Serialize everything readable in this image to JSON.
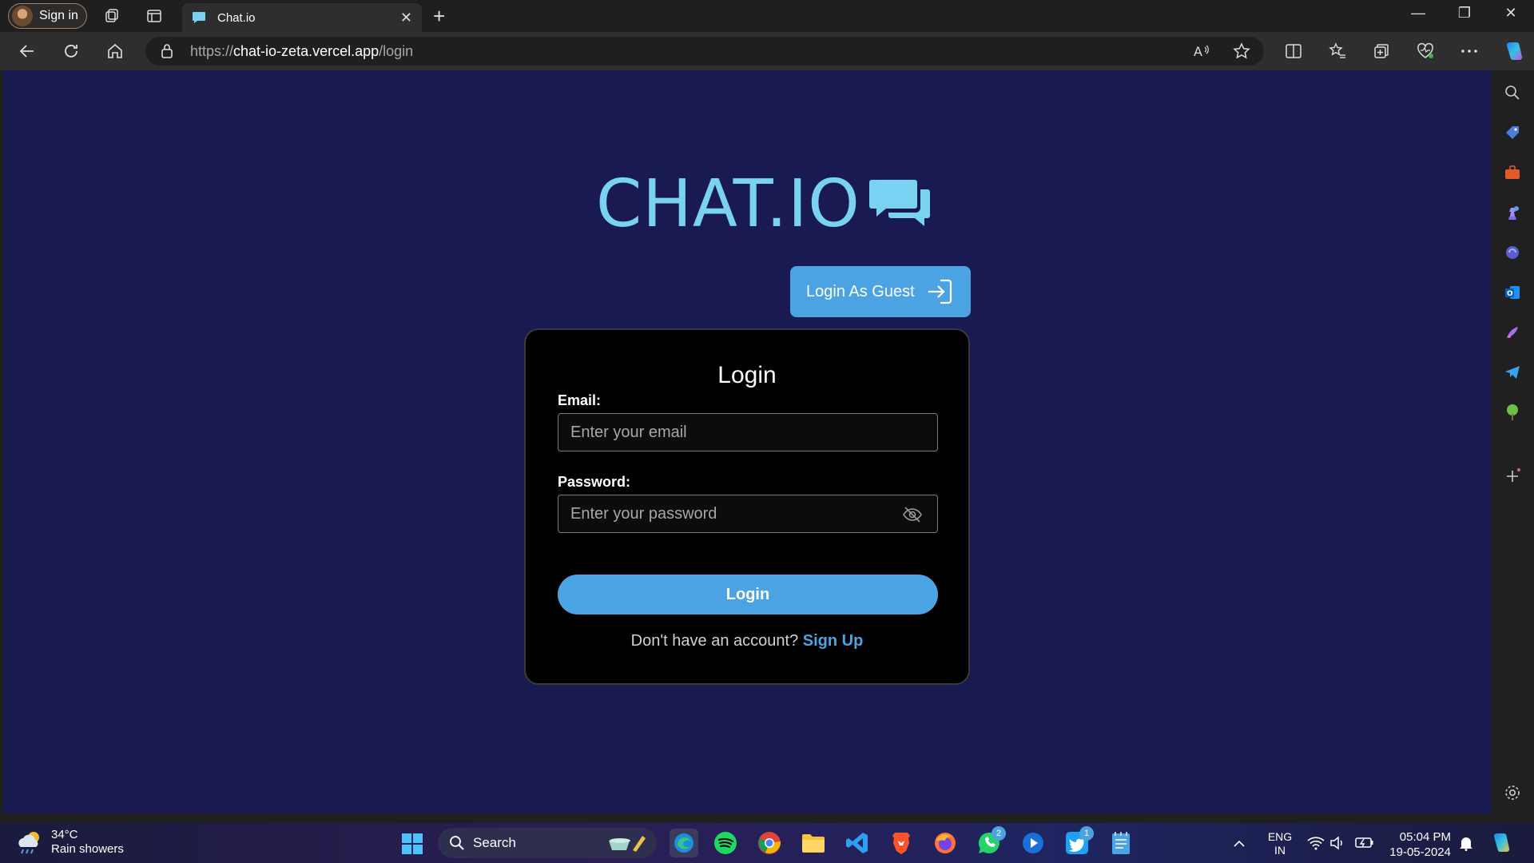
{
  "browser": {
    "profile_label": "Sign in",
    "tab_title": "Chat.io",
    "url_scheme": "https://",
    "url_host": "chat-io-zeta.vercel.app",
    "url_path": "/login"
  },
  "page": {
    "logo_text": "CHAT.IO",
    "guest_button": "Login As Guest",
    "form_title": "Login",
    "email_label": "Email:",
    "email_placeholder": "Enter your email",
    "password_label": "Password:",
    "password_placeholder": "Enter your password",
    "login_button": "Login",
    "signup_prompt": "Don't have an account?",
    "signup_link": "Sign Up"
  },
  "taskbar": {
    "weather_temp": "34°C",
    "weather_desc": "Rain showers",
    "search_label": "Search",
    "whatsapp_badge": "2",
    "twitter_badge": "1",
    "lang_top": "ENG",
    "lang_bottom": "IN",
    "time": "05:04 PM",
    "date": "19-05-2024"
  },
  "colors": {
    "page_background": "#1a1a52",
    "accent": "#4ca3e3",
    "logo": "#79d2f2"
  }
}
